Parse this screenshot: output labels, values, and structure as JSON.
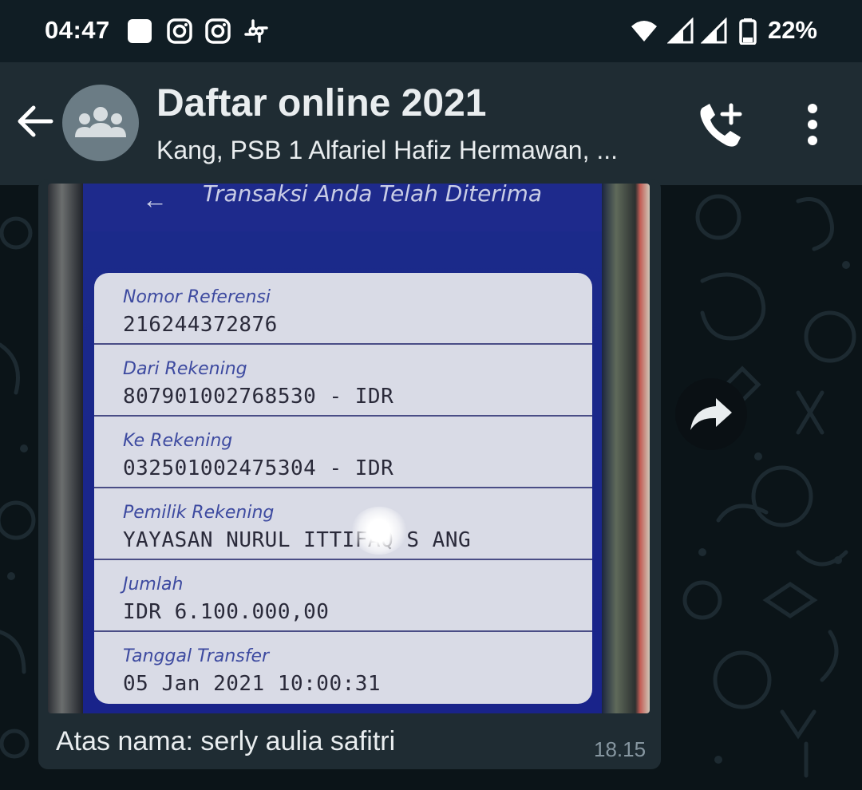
{
  "status_bar": {
    "time": "04:47",
    "battery_percent": "22%",
    "icons": [
      "square-notification-icon",
      "instagram-icon",
      "instagram-icon",
      "slack-icon",
      "wifi-icon",
      "signal-icon",
      "signal-icon",
      "battery-icon"
    ]
  },
  "header": {
    "title": "Daftar online 2021",
    "subtitle": "Kang, PSB 1 Alfariel Hafiz Hermawan, ...",
    "icons": [
      "back-arrow-icon",
      "group-avatar-icon",
      "add-call-icon",
      "more-options-icon"
    ]
  },
  "message": {
    "image_screen": {
      "header": "Transaksi Anda Telah Diterima",
      "fields": [
        {
          "label": "Nomor Referensi",
          "value": "216244372876"
        },
        {
          "label": "Dari Rekening",
          "value": "807901002768530 - IDR"
        },
        {
          "label": "Ke Rekening",
          "value": "032501002475304 - IDR"
        },
        {
          "label": "Pemilik Rekening",
          "value": "YAYASAN NURUL ITTIFAQ S    ANG"
        },
        {
          "label": "Jumlah",
          "value": "IDR 6.100.000,00"
        },
        {
          "label": "Tanggal Transfer",
          "value": "05 Jan 2021 10:00:31"
        }
      ]
    },
    "caption": "Atas nama: serly aulia safitri",
    "time": "18.15"
  },
  "colors": {
    "status_bar": "#101d24",
    "app_bar": "#1f2c33",
    "chat_background": "#0b1418",
    "bubble": "#1f2c33",
    "meta_text": "#8696a0"
  }
}
